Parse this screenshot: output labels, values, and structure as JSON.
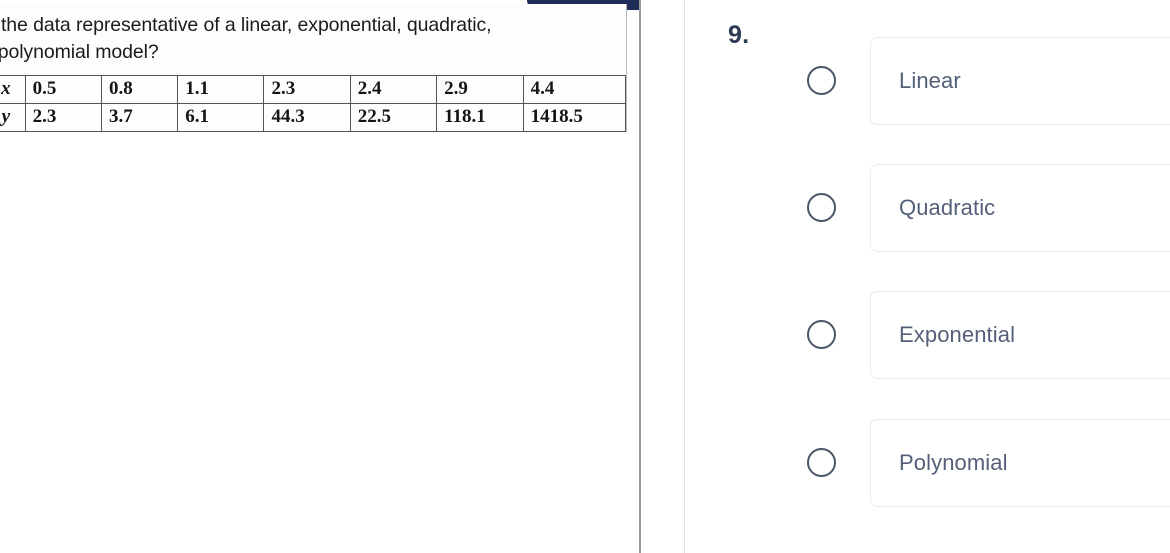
{
  "left_pane": {
    "question_text": "s the data representative of a linear, exponential, quadratic,\nr polynomial model?",
    "table": {
      "row_labels": [
        "x",
        "y"
      ],
      "x_values": [
        "0.5",
        "0.8",
        "1.1",
        "2.3",
        "2.4",
        "2.9",
        "4.4"
      ],
      "y_values": [
        "2.3",
        "3.7",
        "6.1",
        "44.3",
        "22.5",
        "118.1",
        "1418.5"
      ]
    },
    "navy_tab_color": "#1e2c57"
  },
  "right_pane": {
    "question_number": "9.",
    "question_number_color": "#2d3a54",
    "option_text_color": "#54607a",
    "card_border_color": "#ececec",
    "radio_border_color": "#4a5568",
    "options": [
      {
        "label": "Linear",
        "selected": false
      },
      {
        "label": "Quadratic",
        "selected": false
      },
      {
        "label": "Exponential",
        "selected": false
      },
      {
        "label": "Polynomial",
        "selected": false
      }
    ]
  }
}
